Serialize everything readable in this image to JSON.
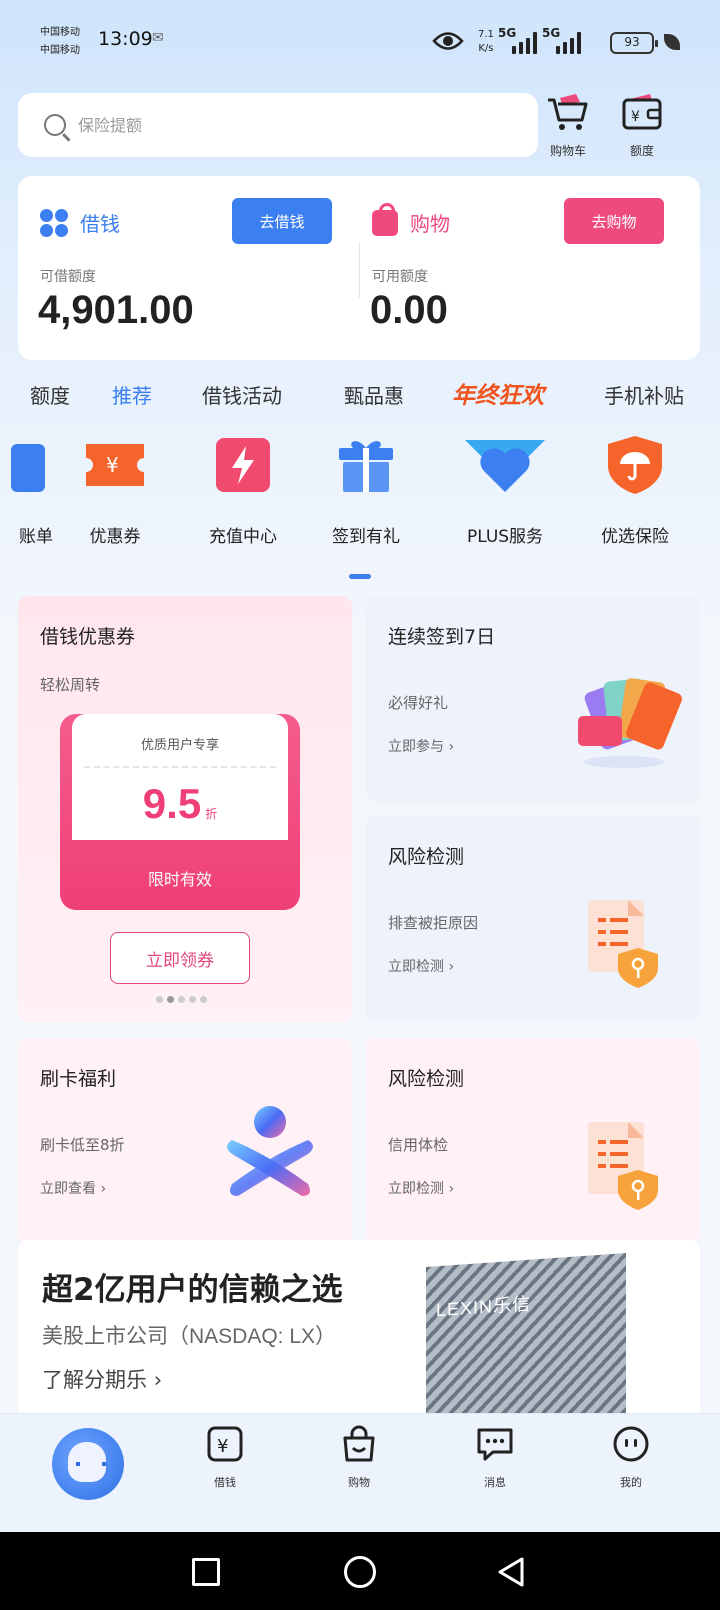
{
  "status_bar": {
    "carrier_top": "中国移动",
    "carrier_bottom": "中国移动",
    "time": "13:09",
    "speed_value": "7.1",
    "speed_unit": "K/s",
    "net1": "5G",
    "net2": "5G",
    "battery": "93"
  },
  "search": {
    "placeholder": "保险提额"
  },
  "top_icons": {
    "cart_label": "购物车",
    "quota_label": "额度"
  },
  "account": {
    "borrow": {
      "title": "借钱",
      "button": "去借钱",
      "sub_label": "可借额度",
      "amount": "4,901.00"
    },
    "shop": {
      "title": "购物",
      "button": "去购物",
      "sub_label": "可用额度",
      "amount": "0.00"
    },
    "colors": {
      "blue": "#3b7ff0",
      "pink": "#ef4a7e"
    }
  },
  "tabs": [
    "额度",
    "推荐",
    "借钱活动",
    "甄品惠",
    "年终狂欢",
    "手机补贴"
  ],
  "active_tab": "推荐",
  "feature_icons": [
    {
      "label": "账单",
      "icon": "bill-icon"
    },
    {
      "label": "优惠券",
      "icon": "coupon-icon"
    },
    {
      "label": "充值中心",
      "icon": "lightning-icon"
    },
    {
      "label": "签到有礼",
      "icon": "gift-icon"
    },
    {
      "label": "PLUS服务",
      "icon": "plus-heart-icon"
    },
    {
      "label": "优选保险",
      "icon": "umbrella-shield-icon"
    }
  ],
  "cards": {
    "coupon_card": {
      "title": "借钱优惠券",
      "subtitle": "轻松周转",
      "coupon_header": "优质用户专享",
      "coupon_value": "9.5",
      "coupon_unit": "折",
      "coupon_footer": "限时有效",
      "cta": "立即领券"
    },
    "checkin_card": {
      "title": "连续签到7日",
      "desc": "必得好礼",
      "link": "立即参与"
    },
    "risk_card_1": {
      "title": "风险检测",
      "desc": "排查被拒原因",
      "link": "立即检测"
    },
    "swipe_card": {
      "title": "刷卡福利",
      "desc": "刷卡低至8折",
      "link": "立即查看"
    },
    "risk_card_2": {
      "title": "风险检测",
      "desc": "信用体检",
      "link": "立即检测"
    }
  },
  "banner": {
    "headline": "超2亿用户的信赖之选",
    "subline": "美股上市公司（NASDAQ: LX）",
    "more": "了解分期乐",
    "building_logo": "LEXIN乐信"
  },
  "bottom_nav": [
    {
      "label": "借钱",
      "icon": "yuan-card-icon"
    },
    {
      "label": "购物",
      "icon": "shopping-bag-icon"
    },
    {
      "label": "消息",
      "icon": "chat-bubble-icon"
    },
    {
      "label": "我的",
      "icon": "profile-face-icon"
    }
  ]
}
